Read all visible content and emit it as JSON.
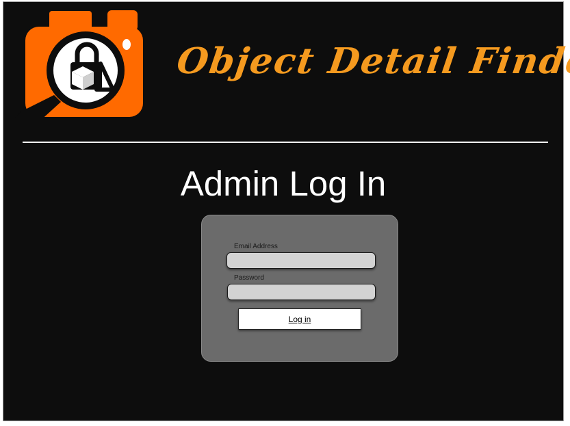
{
  "header": {
    "logo_icon": "camera-magnifier-logo",
    "app_title": "Object Detail Finder"
  },
  "main": {
    "page_title": "Admin Log In",
    "form": {
      "email_label": "Email Address",
      "email_value": "",
      "password_label": "Password",
      "password_value": "",
      "submit_label": "Log in"
    }
  },
  "colors": {
    "background": "#0d0d0d",
    "logo_orange": "#ff6a00",
    "title_orange": "#f59a1f",
    "card": "#6b6b6b",
    "input": "#d3d3d3"
  }
}
